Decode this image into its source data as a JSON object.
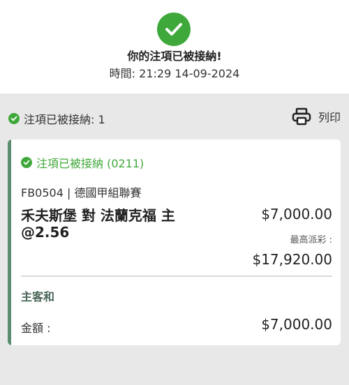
{
  "confirmation": {
    "title": "你的注項已被接納!",
    "time": "時間: 21:29 14-09-2024"
  },
  "summary": {
    "accepted_label": "注項已被接納: 1",
    "print_label": "列印"
  },
  "bet": {
    "status": "注項已被接納 (0211)",
    "league": "FB0504 | 德國甲組聯賽",
    "match": "禾夫斯堡 對 法蘭克福 主@2.56",
    "stake": "$7,000.00",
    "max_payout_label": "最高派彩 :",
    "max_payout": "$17,920.00",
    "selection": "主客和",
    "amount_label": "金額 :",
    "amount": "$7,000.00"
  },
  "colors": {
    "success": "#3fa83a",
    "card_accent": "#5a8c6e"
  },
  "icons": [
    "check-circle-icon",
    "printer-icon"
  ]
}
